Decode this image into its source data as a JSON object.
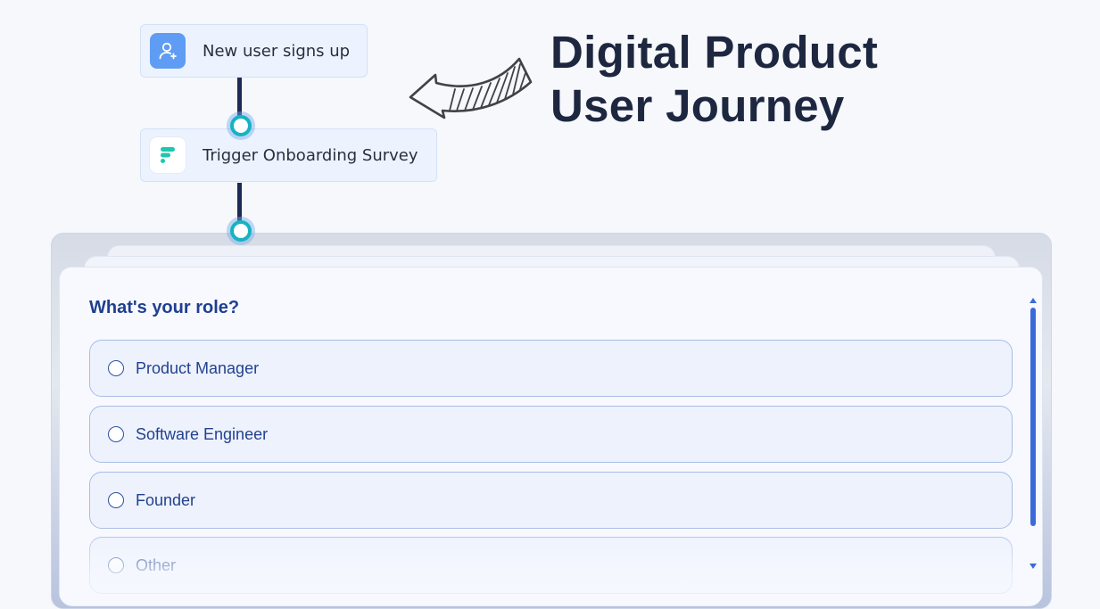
{
  "flow": {
    "nodes": [
      {
        "label": "New user signs up",
        "icon": "user-plus-icon"
      },
      {
        "label": "Trigger Onboarding Survey",
        "icon": "survey-logo-icon"
      }
    ]
  },
  "heading": {
    "line1": "Digital Product",
    "line2": "User Journey"
  },
  "survey": {
    "question": "What's your role?",
    "options": [
      {
        "label": "Product Manager"
      },
      {
        "label": "Software Engineer"
      },
      {
        "label": "Founder"
      },
      {
        "label": "Other"
      }
    ]
  },
  "colors": {
    "accent": "#3a6ad9",
    "connector": "#1e2a55",
    "dot": "#16b3c2",
    "heading": "#1e2740"
  }
}
